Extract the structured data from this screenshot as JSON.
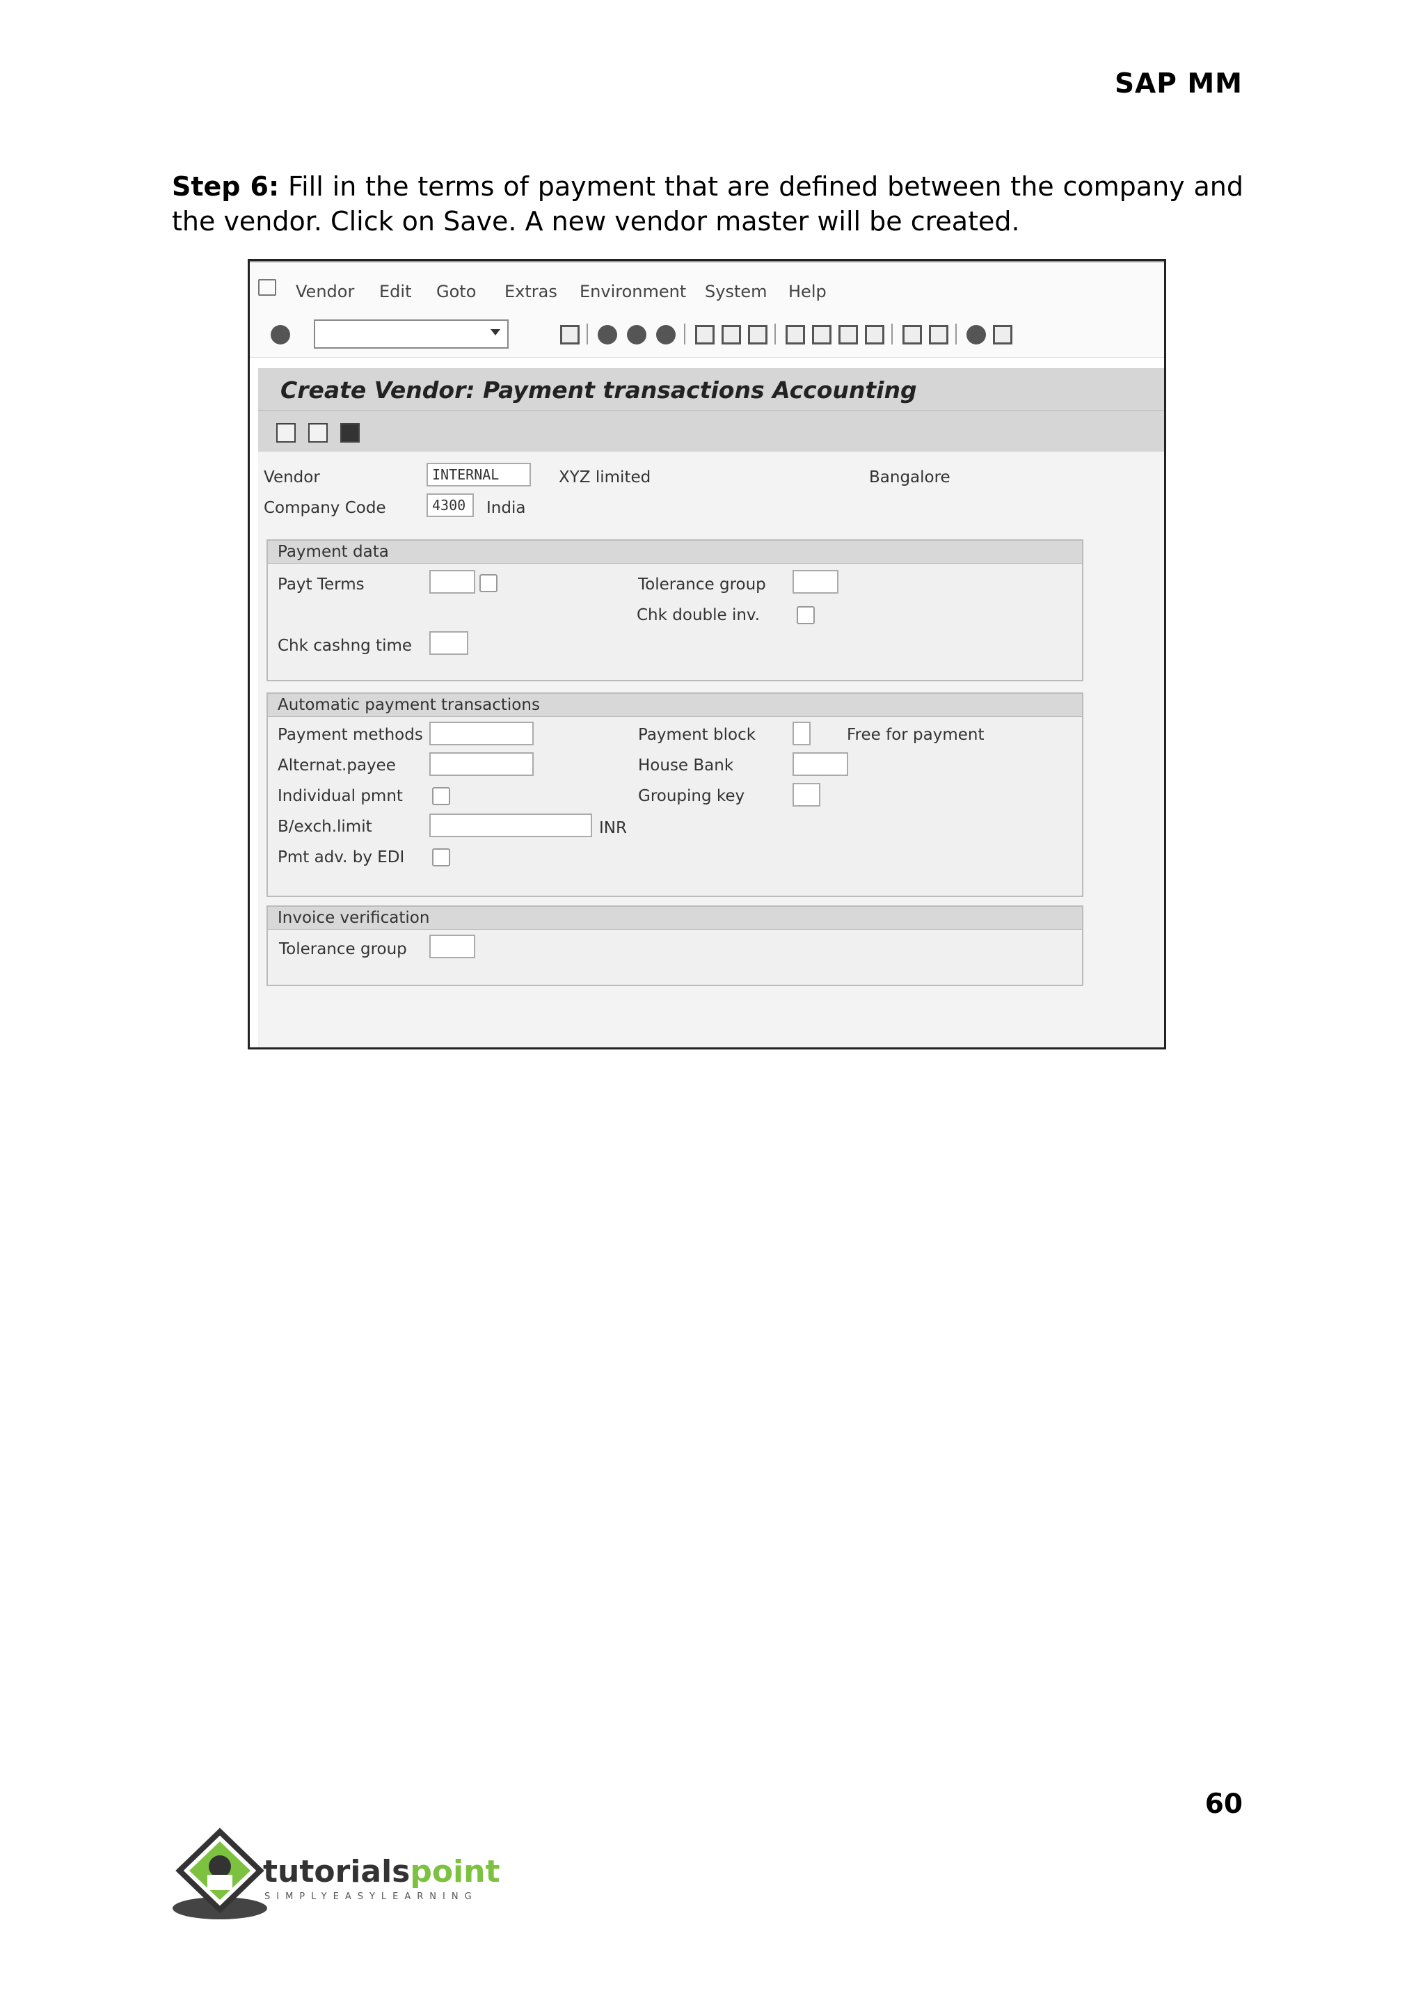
{
  "header": {
    "title": "SAP MM"
  },
  "step": {
    "label": "Step 6:",
    "text": " Fill in the terms of payment that are defined between the company and the vendor. Click on Save. A new vendor master will be created."
  },
  "page": {
    "number": "60"
  },
  "sap": {
    "menu": [
      "Vendor",
      "Edit",
      "Goto",
      "Extras",
      "Environment",
      "System",
      "Help"
    ],
    "title": "Create Vendor: Payment transactions Accounting",
    "header_fields": {
      "vendor_label": "Vendor",
      "vendor_value": "INTERNAL",
      "vendor_name": "XYZ limited",
      "vendor_city": "Bangalore",
      "company_code_label": "Company Code",
      "company_code_value": "4300",
      "company_country": "India"
    },
    "payment_data": {
      "heading": "Payment data",
      "payt_terms": "Payt Terms",
      "tolerance_group": "Tolerance group",
      "chk_double_inv": "Chk double inv.",
      "chk_cashng_time": "Chk cashng time"
    },
    "auto_payment": {
      "heading": "Automatic payment transactions",
      "payment_methods": "Payment methods",
      "payment_block": "Payment block",
      "free_for_payment": "Free for payment",
      "alternat_payee": "Alternat.payee",
      "house_bank": "House Bank",
      "individual_pmnt": "Individual pmnt",
      "grouping_key": "Grouping key",
      "bexch_limit": "B/exch.limit",
      "currency": "INR",
      "pmt_adv_edi": "Pmt adv. by EDI"
    },
    "invoice_verification": {
      "heading": "Invoice verification",
      "tolerance_group": "Tolerance group"
    }
  },
  "logo": {
    "part1": "tutorials",
    "part2": "point",
    "tagline": "SIMPLYEASYLEARNING"
  }
}
